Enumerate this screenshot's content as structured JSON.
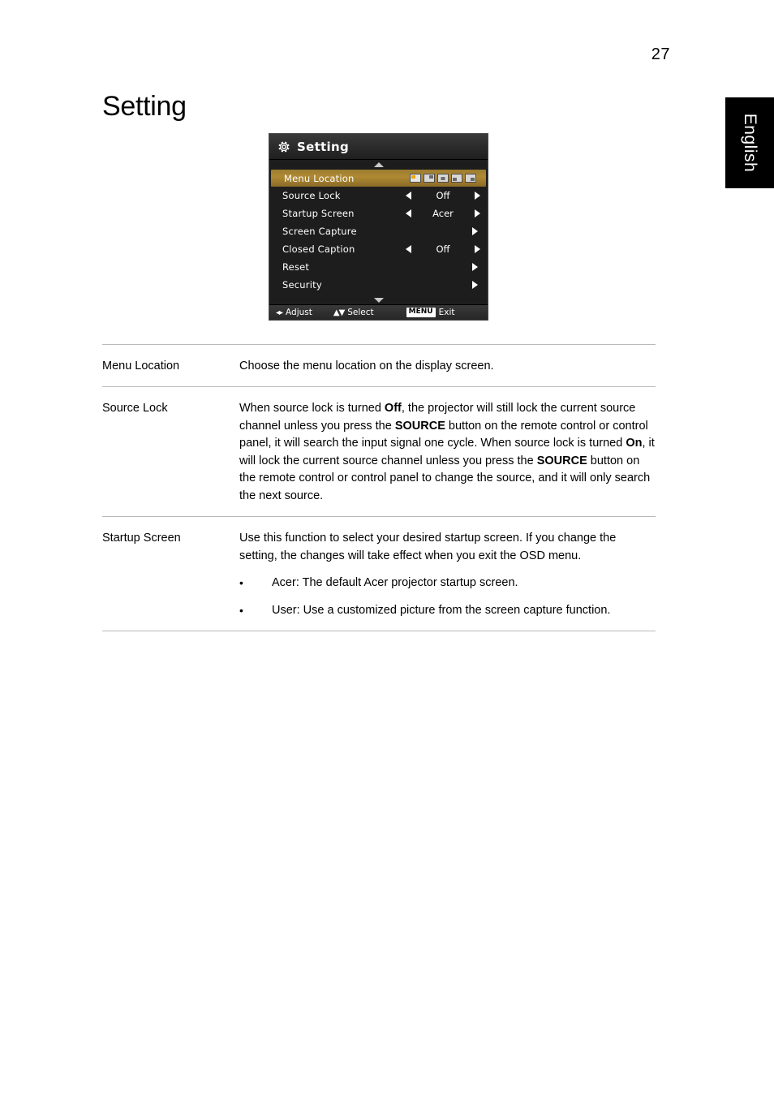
{
  "page": {
    "number": "27",
    "lang_tab": "English",
    "heading": "Setting"
  },
  "osd": {
    "title": "Setting",
    "title_icon": "gear-icon",
    "scroll_up_icon": "triangle-up-icon",
    "scroll_down_icon": "triangle-down-icon",
    "rows": [
      {
        "label": "Menu Location",
        "value": "",
        "type": "location"
      },
      {
        "label": "Source Lock",
        "value": "Off",
        "type": "arrows"
      },
      {
        "label": "Startup Screen",
        "value": "Acer",
        "type": "arrows"
      },
      {
        "label": "Screen Capture",
        "value": "",
        "type": "right"
      },
      {
        "label": "Closed Caption",
        "value": "Off",
        "type": "arrows"
      },
      {
        "label": "Reset",
        "value": "",
        "type": "right"
      },
      {
        "label": "Security",
        "value": "",
        "type": "right"
      }
    ],
    "footer": {
      "adjust_icon": "left-right-arrows-icon",
      "adjust": "Adjust",
      "select_icon": "up-down-arrows-icon",
      "select": "Select",
      "menu_key": "MENU",
      "exit": "Exit"
    }
  },
  "table": {
    "rows": [
      {
        "term": "Menu Location",
        "text": "Choose the menu location on the display screen.",
        "bullets": []
      },
      {
        "term": "Source Lock",
        "text_parts": [
          {
            "t": "When source lock is turned ",
            "b": false
          },
          {
            "t": "Off",
            "b": true
          },
          {
            "t": ", the projector will still lock the current source channel unless you press the ",
            "b": false
          },
          {
            "t": "SOURCE",
            "b": true
          },
          {
            "t": " button on the remote control or control panel, it will search the input signal one cycle. When source lock is turned ",
            "b": false
          },
          {
            "t": "On",
            "b": true
          },
          {
            "t": ", it will lock the current source channel unless you press the ",
            "b": false
          },
          {
            "t": "SOURCE",
            "b": true
          },
          {
            "t": " button on the remote control or control panel to change the source, and it will only search the next source.",
            "b": false
          }
        ],
        "bullets": []
      },
      {
        "term": "Startup Screen",
        "text": "Use this function to select your desired startup screen. If you change the setting, the changes will take effect when you exit the OSD menu.",
        "bullets": [
          {
            "marker": "•",
            "text": "Acer: The default Acer projector startup screen."
          },
          {
            "marker": "•",
            "text": "User: Use a customized picture from the screen capture function."
          }
        ]
      }
    ]
  }
}
